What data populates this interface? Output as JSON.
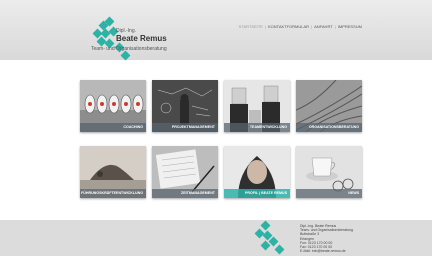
{
  "header": {
    "logo_pre": "Dipl.-Ing.",
    "logo_name": "Beate Remus",
    "logo_sub": "Team- und Organisationsberatung",
    "nav": [
      {
        "label": "Startseite",
        "active": true
      },
      {
        "label": "Kontaktformular",
        "active": false
      },
      {
        "label": "Anfahrt",
        "active": false
      },
      {
        "label": "Impressum",
        "active": false
      }
    ]
  },
  "tiles": [
    {
      "label": "Coaching",
      "image": "targets-photo"
    },
    {
      "label": "Projektmanagement",
      "image": "chalkboard-photo"
    },
    {
      "label": "Teamentwicklung",
      "image": "paperbag-heads-photo"
    },
    {
      "label": "Organisationsberatung",
      "image": "rail-tracks-photo"
    },
    {
      "label": "Führungskräfteentwicklung",
      "image": "yoga-photo"
    },
    {
      "label": "Zeitmanagement",
      "image": "notebook-pen-photo"
    },
    {
      "label": "Profil | Beate Remus",
      "image": "portrait-photo",
      "highlight": true
    },
    {
      "label": "News",
      "image": "coffee-cup-photo"
    }
  ],
  "footer": {
    "address_lines": [
      "Dipl.-Ing. Beate Remus",
      "Team- und Organisationsberatung",
      "Buttstraße 3",
      "Erlangen",
      "",
      "Fon: 0123 170 00 00",
      "Fax: 0123 170 00 00",
      "E-Mail: info@beate-remus.de"
    ]
  },
  "colors": {
    "accent": "#2db3a6",
    "header_bg": "#e0e0e0",
    "footer_bg": "#dcdcdc"
  }
}
